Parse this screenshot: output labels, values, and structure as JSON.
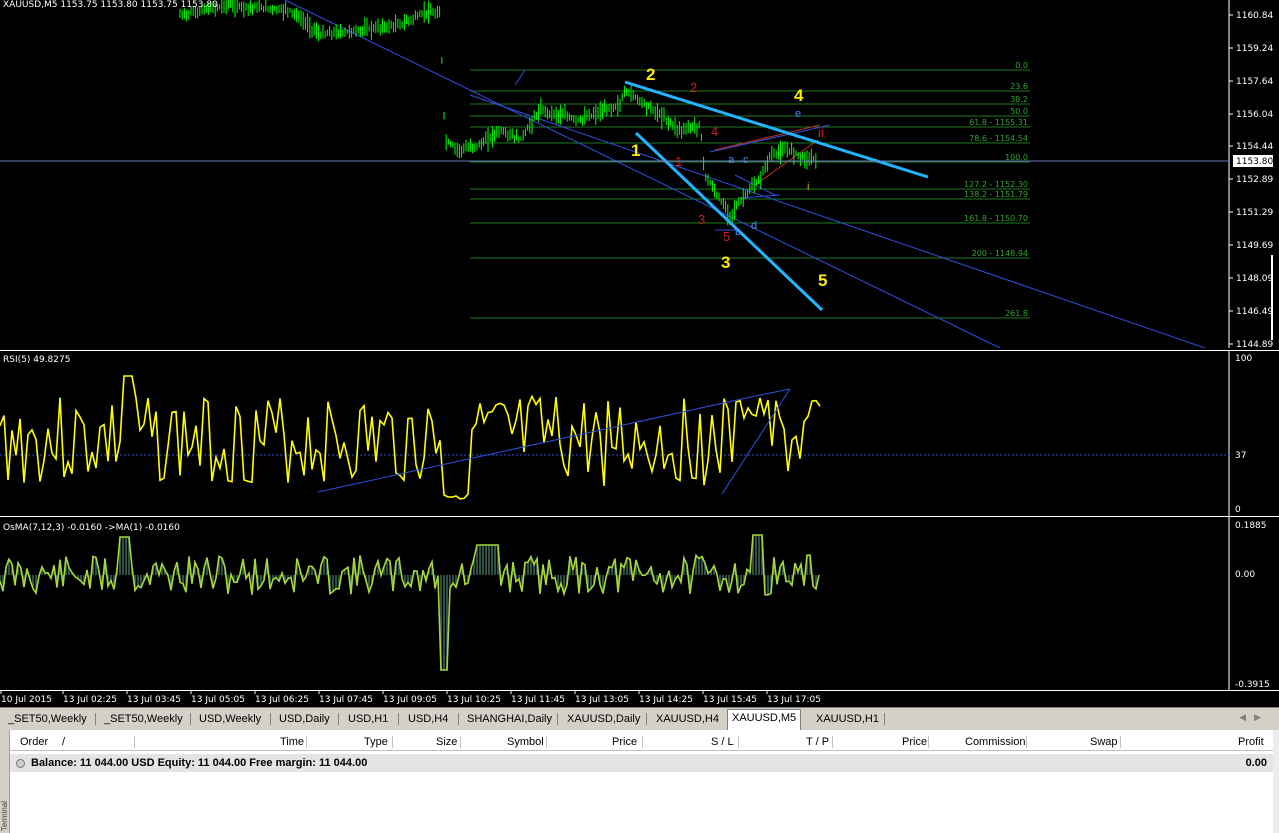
{
  "price_chart": {
    "header": "XAUUSD,M5  1153.75 1153.80 1153.75 1153.80",
    "current_price": "1153.80",
    "price_axis": [
      "1160.84",
      "1159.24",
      "1157.64",
      "1156.04",
      "1154.44",
      "1152.89",
      "1151.29",
      "1149.69",
      "1148.09",
      "1146.49",
      "1144.89"
    ],
    "fib_levels": [
      {
        "label": "0.0"
      },
      {
        "label": "23.6"
      },
      {
        "label": "38.2"
      },
      {
        "label": "50.0"
      },
      {
        "label": "61.8 - 1155.31"
      },
      {
        "label": "78.6 - 1154.54"
      },
      {
        "label": "100.0"
      },
      {
        "label": "127.2 - 1152.30"
      },
      {
        "label": "138.2 - 1151.79"
      },
      {
        "label": "161.8 - 1150.70"
      },
      {
        "label": "200 - 1148.94"
      },
      {
        "label": "261.8"
      }
    ],
    "wave_labels": {
      "yellow": [
        "2",
        "1",
        "4",
        "3",
        "5"
      ],
      "red": [
        "2",
        "1",
        "4",
        "3",
        "5",
        "ii"
      ],
      "blue": [
        "e",
        "a",
        "c",
        "b",
        "d"
      ],
      "orange": [
        "i"
      ]
    }
  },
  "rsi": {
    "header": "RSI(5) 49.8275",
    "axis": [
      "100",
      "37",
      "0"
    ]
  },
  "osma": {
    "header": "OsMA(7,12,3) -0.0160  ->MA(1) -0.0160",
    "axis": [
      "0.1885",
      "0.00",
      "-0.3915"
    ]
  },
  "time_axis": [
    "10 Jul 2015",
    "13 Jul 02:25",
    "13 Jul 03:45",
    "13 Jul 05:05",
    "13 Jul 06:25",
    "13 Jul 07:45",
    "13 Jul 09:05",
    "13 Jul 10:25",
    "13 Jul 11:45",
    "13 Jul 13:05",
    "13 Jul 14:25",
    "13 Jul 15:45",
    "13 Jul 17:05"
  ],
  "tabs": [
    "_SET50,Weekly",
    "_SET50,Weekly",
    "USD,Weekly",
    "USD,Daily",
    "USD,H1",
    "USD,H4",
    "SHANGHAI,Daily",
    "XAUUSD,Daily",
    "XAUUSD,H4",
    "XAUUSD,M5",
    "XAUUSD,H1"
  ],
  "active_tab": "XAUUSD,M5",
  "terminal": {
    "columns": [
      "Order",
      "/",
      "Time",
      "Type",
      "Size",
      "Symbol",
      "Price",
      "S / L",
      "T / P",
      "Price",
      "Commission",
      "Swap",
      "Profit"
    ],
    "balance_text": "Balance: 11 044.00 USD  Equity: 11 044.00  Free margin: 11 044.00",
    "balance_profit": "0.00",
    "side_label": "Terminal"
  },
  "colors": {
    "bull_candle": "#00ff00",
    "fib_line": "#1e7a1e",
    "trendline": "#3050e0",
    "thick_line": "#22b4ff",
    "rsi_line": "#ffff00",
    "osma_line": "#a8d838",
    "osma_hist": "#3a6a5a"
  }
}
